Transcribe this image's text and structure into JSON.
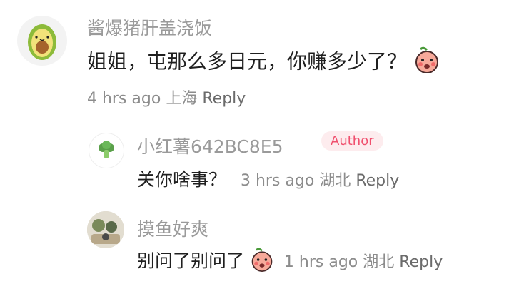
{
  "comments": [
    {
      "username": "酱爆猪肝盖浇饭",
      "avatar": "avocado-icon",
      "text": "姐姐，屯那么多日元，你赚多少了？",
      "sticker": "peach-sticker",
      "time": "4 hrs ago",
      "location": "上海",
      "reply": "Reply"
    },
    {
      "username": "小红薯642BC8E5",
      "avatar": "broccoli-icon",
      "badge": "Author",
      "text": "关你啥事？",
      "time": "3 hrs ago",
      "location": "湖北",
      "reply": "Reply"
    },
    {
      "username": "摸鱼好爽",
      "avatar": "photo-avatar",
      "text": "别问了别问了",
      "sticker": "peach-sticker",
      "time": "1 hrs ago",
      "location": "湖北",
      "reply": "Reply"
    }
  ],
  "colors": {
    "author_badge_bg": "#fdecee",
    "author_badge_text": "#f0506e",
    "username": "#9a9a9a",
    "meta": "#8c8c8c"
  }
}
